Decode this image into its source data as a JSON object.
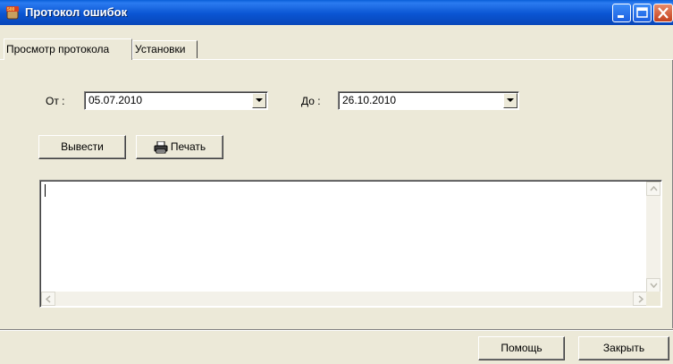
{
  "window": {
    "title": "Протокол ошибок"
  },
  "tabs": [
    {
      "label": "Просмотр протокола"
    },
    {
      "label": "Установки"
    }
  ],
  "filters": {
    "from_label": "От :",
    "from_value": "05.07.2010",
    "to_label": "До :",
    "to_value": "26.10.2010"
  },
  "actions": {
    "show_label": "Вывести",
    "print_label": "Печать"
  },
  "log": {
    "text": ""
  },
  "footer": {
    "help_label": "Помощь",
    "close_label": "Закрыть"
  },
  "colors": {
    "titlebar": "#0a55d3",
    "dialog_bg": "#ece9d8",
    "close_button": "#c3411e"
  }
}
